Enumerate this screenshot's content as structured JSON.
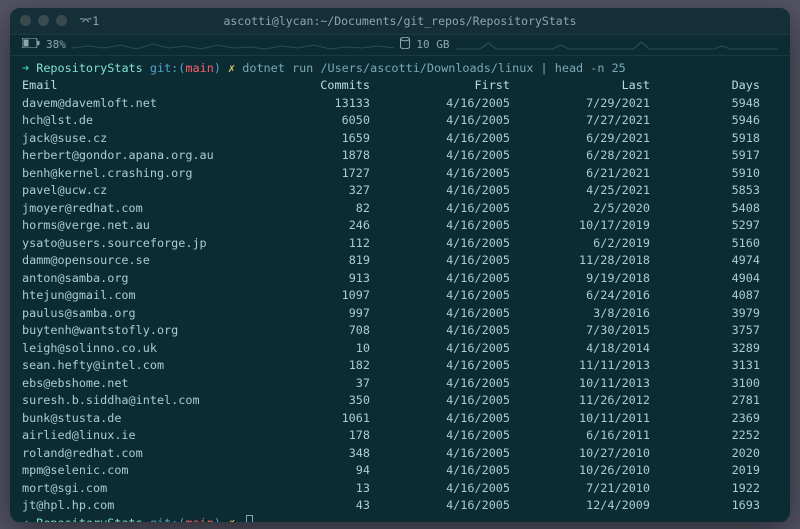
{
  "window": {
    "title": "ascotti@lycan:~/Documents/git_repos/RepositoryStats",
    "left_label": "⌤1"
  },
  "status": {
    "battery_pct": "38%",
    "disk": "10 GB"
  },
  "prompt": {
    "arrow": "➜",
    "dir": "RepositoryStats",
    "git_label": "git:(",
    "branch": "main",
    "git_close": ")",
    "dirty": "✗",
    "command": "dotnet run /Users/ascotti/Downloads/linux | head -n 25"
  },
  "headers": {
    "email": "Email",
    "commits": "Commits",
    "first": "First",
    "last": "Last",
    "days": "Days"
  },
  "rows": [
    {
      "email": "davem@davemloft.net",
      "commits": "13133",
      "first": "4/16/2005",
      "last": "7/29/2021",
      "days": "5948"
    },
    {
      "email": "hch@lst.de",
      "commits": "6050",
      "first": "4/16/2005",
      "last": "7/27/2021",
      "days": "5946"
    },
    {
      "email": "jack@suse.cz",
      "commits": "1659",
      "first": "4/16/2005",
      "last": "6/29/2021",
      "days": "5918"
    },
    {
      "email": "herbert@gondor.apana.org.au",
      "commits": "1878",
      "first": "4/16/2005",
      "last": "6/28/2021",
      "days": "5917"
    },
    {
      "email": "benh@kernel.crashing.org",
      "commits": "1727",
      "first": "4/16/2005",
      "last": "6/21/2021",
      "days": "5910"
    },
    {
      "email": "pavel@ucw.cz",
      "commits": "327",
      "first": "4/16/2005",
      "last": "4/25/2021",
      "days": "5853"
    },
    {
      "email": "jmoyer@redhat.com",
      "commits": "82",
      "first": "4/16/2005",
      "last": "2/5/2020",
      "days": "5408"
    },
    {
      "email": "horms@verge.net.au",
      "commits": "246",
      "first": "4/16/2005",
      "last": "10/17/2019",
      "days": "5297"
    },
    {
      "email": "ysato@users.sourceforge.jp",
      "commits": "112",
      "first": "4/16/2005",
      "last": "6/2/2019",
      "days": "5160"
    },
    {
      "email": "damm@opensource.se",
      "commits": "819",
      "first": "4/16/2005",
      "last": "11/28/2018",
      "days": "4974"
    },
    {
      "email": "anton@samba.org",
      "commits": "913",
      "first": "4/16/2005",
      "last": "9/19/2018",
      "days": "4904"
    },
    {
      "email": "htejun@gmail.com",
      "commits": "1097",
      "first": "4/16/2005",
      "last": "6/24/2016",
      "days": "4087"
    },
    {
      "email": "paulus@samba.org",
      "commits": "997",
      "first": "4/16/2005",
      "last": "3/8/2016",
      "days": "3979"
    },
    {
      "email": "buytenh@wantstofly.org",
      "commits": "708",
      "first": "4/16/2005",
      "last": "7/30/2015",
      "days": "3757"
    },
    {
      "email": "leigh@solinno.co.uk",
      "commits": "10",
      "first": "4/16/2005",
      "last": "4/18/2014",
      "days": "3289"
    },
    {
      "email": "sean.hefty@intel.com",
      "commits": "182",
      "first": "4/16/2005",
      "last": "11/11/2013",
      "days": "3131"
    },
    {
      "email": "ebs@ebshome.net",
      "commits": "37",
      "first": "4/16/2005",
      "last": "10/11/2013",
      "days": "3100"
    },
    {
      "email": "suresh.b.siddha@intel.com",
      "commits": "350",
      "first": "4/16/2005",
      "last": "11/26/2012",
      "days": "2781"
    },
    {
      "email": "bunk@stusta.de",
      "commits": "1061",
      "first": "4/16/2005",
      "last": "10/11/2011",
      "days": "2369"
    },
    {
      "email": "airlied@linux.ie",
      "commits": "178",
      "first": "4/16/2005",
      "last": "6/16/2011",
      "days": "2252"
    },
    {
      "email": "roland@redhat.com",
      "commits": "348",
      "first": "4/16/2005",
      "last": "10/27/2010",
      "days": "2020"
    },
    {
      "email": "mpm@selenic.com",
      "commits": "94",
      "first": "4/16/2005",
      "last": "10/26/2010",
      "days": "2019"
    },
    {
      "email": "mort@sgi.com",
      "commits": "13",
      "first": "4/16/2005",
      "last": "7/21/2010",
      "days": "1922"
    },
    {
      "email": "jt@hpl.hp.com",
      "commits": "43",
      "first": "4/16/2005",
      "last": "12/4/2009",
      "days": "1693"
    }
  ]
}
